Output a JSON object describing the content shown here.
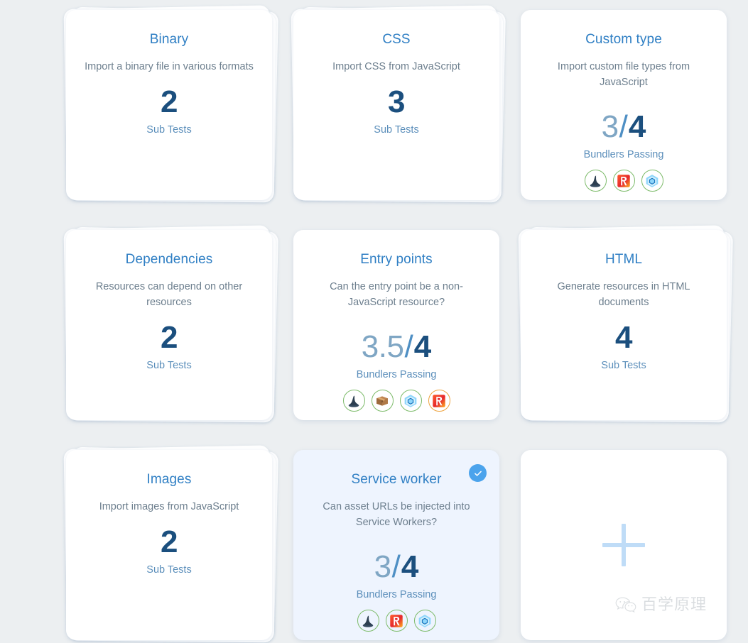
{
  "background_color": "#eceff1",
  "accent_colors": {
    "title_blue": "#2f7fc4",
    "number_navy": "#1b4f7e",
    "fraction_light": "#7fa6c4",
    "slash_blue": "#4e8fc4",
    "label_blue": "#5c8fbb",
    "desc_gray": "#6d7f8e",
    "pass_ring_green": "#7dbb6a",
    "partial_ring_orange": "#eda23c",
    "selected_card_bg": "#eef4fe",
    "check_badge_blue": "#4ba3ec",
    "plus_blue": "#bfdcf7"
  },
  "labels": {
    "sub_tests": "Sub Tests",
    "bundlers_passing": "Bundlers Passing"
  },
  "cards": [
    {
      "id": "binary",
      "title": "Binary",
      "description": "Import a binary file in various formats",
      "metric_kind": "subtests",
      "count": "2",
      "metric_label": "Sub Tests",
      "stacked": true,
      "selected": false
    },
    {
      "id": "css",
      "title": "CSS",
      "description": "Import CSS from JavaScript",
      "metric_kind": "subtests",
      "count": "3",
      "metric_label": "Sub Tests",
      "stacked": true,
      "selected": false
    },
    {
      "id": "custom-type",
      "title": "Custom type",
      "description": "Import custom file types from JavaScript",
      "metric_kind": "fraction",
      "numerator": "3",
      "slash": "/",
      "denominator": "4",
      "metric_label": "Bundlers Passing",
      "stacked": false,
      "selected": false,
      "bundlers": [
        {
          "name": "parcel",
          "icon": "wizard-hat-icon",
          "status": "pass"
        },
        {
          "name": "rollup",
          "icon": "rollup-r-icon",
          "status": "pass"
        },
        {
          "name": "webpack",
          "icon": "webpack-cube-icon",
          "status": "pass"
        }
      ]
    },
    {
      "id": "dependencies",
      "title": "Dependencies",
      "description": "Resources can depend on other resources",
      "metric_kind": "subtests",
      "count": "2",
      "metric_label": "Sub Tests",
      "stacked": true,
      "selected": false
    },
    {
      "id": "entry-points",
      "title": "Entry points",
      "description": "Can the entry point be a non-JavaScript resource?",
      "metric_kind": "fraction",
      "numerator": "3.5",
      "slash": "/",
      "denominator": "4",
      "metric_label": "Bundlers Passing",
      "stacked": false,
      "selected": false,
      "bundlers": [
        {
          "name": "parcel",
          "icon": "wizard-hat-icon",
          "status": "pass"
        },
        {
          "name": "browserify",
          "icon": "cardboard-box-icon",
          "status": "pass"
        },
        {
          "name": "webpack",
          "icon": "webpack-cube-icon",
          "status": "pass"
        },
        {
          "name": "rollup",
          "icon": "rollup-r-icon",
          "status": "partial"
        }
      ]
    },
    {
      "id": "html",
      "title": "HTML",
      "description": "Generate resources in HTML documents",
      "metric_kind": "subtests",
      "count": "4",
      "metric_label": "Sub Tests",
      "stacked": true,
      "selected": false
    },
    {
      "id": "images",
      "title": "Images",
      "description": "Import images from JavaScript",
      "metric_kind": "subtests",
      "count": "2",
      "metric_label": "Sub Tests",
      "stacked": true,
      "selected": false
    },
    {
      "id": "service-worker",
      "title": "Service worker",
      "description": "Can asset URLs be injected into Service Workers?",
      "metric_kind": "fraction",
      "numerator": "3",
      "slash": "/",
      "denominator": "4",
      "metric_label": "Bundlers Passing",
      "stacked": false,
      "selected": true,
      "bundlers": [
        {
          "name": "parcel",
          "icon": "wizard-hat-icon",
          "status": "pass"
        },
        {
          "name": "rollup",
          "icon": "rollup-r-icon",
          "status": "pass"
        },
        {
          "name": "webpack",
          "icon": "webpack-cube-icon",
          "status": "pass"
        }
      ]
    },
    {
      "id": "add-new",
      "kind": "add",
      "icon": "plus-icon"
    }
  ],
  "watermark": {
    "icon": "wechat-icon",
    "text": "百学原理"
  }
}
